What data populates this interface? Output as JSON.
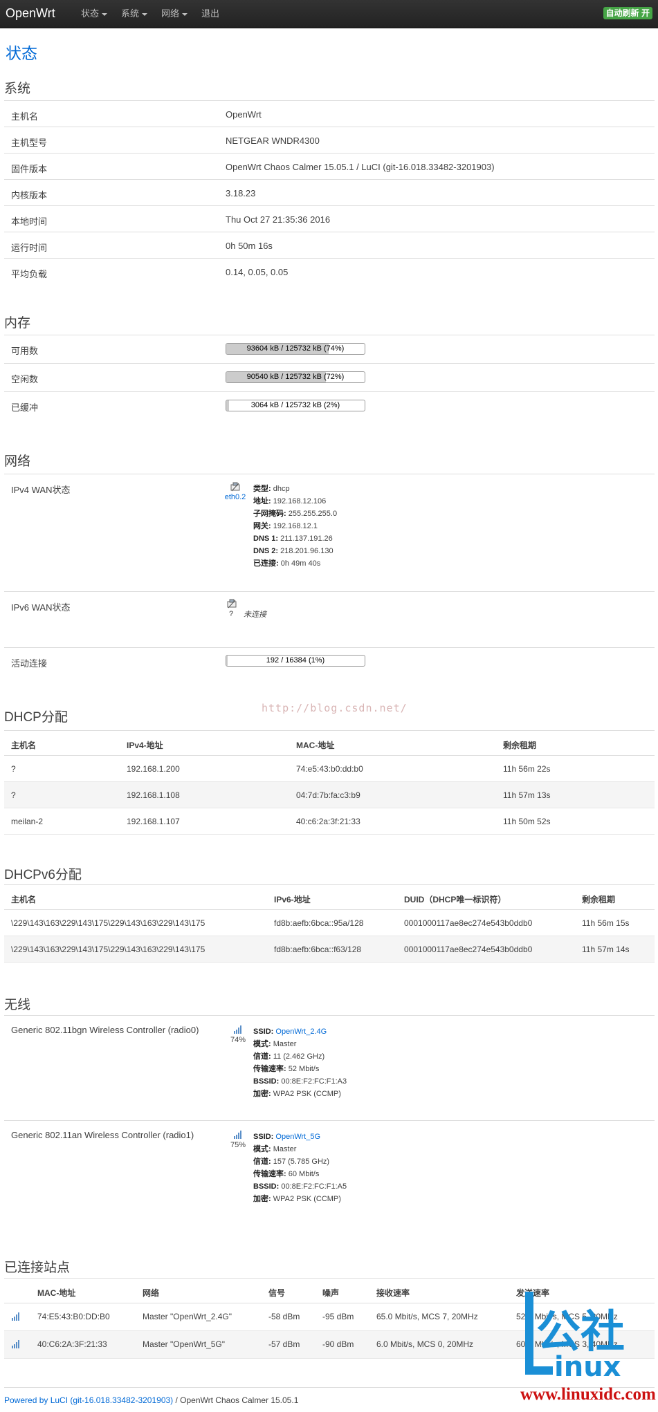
{
  "navbar": {
    "brand": "OpenWrt",
    "menu": [
      "状态",
      "系统",
      "网络",
      "退出"
    ],
    "auto_refresh": "自动刷新 开"
  },
  "page_title": "状态",
  "system": {
    "title": "系统",
    "rows": [
      {
        "label": "主机名",
        "value": "OpenWrt"
      },
      {
        "label": "主机型号",
        "value": "NETGEAR WNDR4300"
      },
      {
        "label": "固件版本",
        "value": "OpenWrt Chaos Calmer 15.05.1 / LuCI (git-16.018.33482-3201903)"
      },
      {
        "label": "内核版本",
        "value": "3.18.23"
      },
      {
        "label": "本地时间",
        "value": "Thu Oct 27 21:35:36 2016"
      },
      {
        "label": "运行时间",
        "value": "0h 50m 16s"
      },
      {
        "label": "平均负载",
        "value": "0.14, 0.05, 0.05"
      }
    ]
  },
  "memory": {
    "title": "内存",
    "rows": [
      {
        "label": "可用数",
        "text": "93604 kB / 125732 kB (74%)",
        "percent": 74
      },
      {
        "label": "空闲数",
        "text": "90540 kB / 125732 kB (72%)",
        "percent": 72
      },
      {
        "label": "已缓冲",
        "text": "3064 kB / 125732 kB (2%)",
        "percent": 2
      }
    ]
  },
  "network": {
    "title": "网络",
    "ipv4_label": "IPv4 WAN状态",
    "ipv4_iface": "eth0.2",
    "ipv4_lines": [
      {
        "k": "类型:",
        "v": "dhcp"
      },
      {
        "k": "地址:",
        "v": "192.168.12.106"
      },
      {
        "k": "子网掩码:",
        "v": "255.255.255.0"
      },
      {
        "k": "网关:",
        "v": "192.168.12.1"
      },
      {
        "k": "DNS 1:",
        "v": "211.137.191.26"
      },
      {
        "k": "DNS 2:",
        "v": "218.201.96.130"
      },
      {
        "k": "已连接:",
        "v": "0h 49m 40s"
      }
    ],
    "ipv6_label": "IPv6 WAN状态",
    "ipv6_iface": "?",
    "ipv6_status": "未连接",
    "conn_label": "活动连接",
    "conn_text": "192 / 16384 (1%)",
    "conn_percent": 1
  },
  "watermark": "http://blog.csdn.net/",
  "dhcp": {
    "title": "DHCP分配",
    "headers": [
      "主机名",
      "IPv4-地址",
      "MAC-地址",
      "剩余租期"
    ],
    "rows": [
      [
        "?",
        "192.168.1.200",
        "74:e5:43:b0:dd:b0",
        "11h 56m 22s"
      ],
      [
        "?",
        "192.168.1.108",
        "04:7d:7b:fa:c3:b9",
        "11h 57m 13s"
      ],
      [
        "meilan-2",
        "192.168.1.107",
        "40:c6:2a:3f:21:33",
        "11h 50m 52s"
      ]
    ]
  },
  "dhcpv6": {
    "title": "DHCPv6分配",
    "headers": [
      "主机名",
      "IPv6-地址",
      "DUID（DHCP唯一标识符）",
      "剩余租期"
    ],
    "rows": [
      [
        "\\229\\143\\163\\229\\143\\175\\229\\143\\163\\229\\143\\175",
        "fd8b:aefb:6bca::95a/128",
        "0001000117ae8ec274e543b0ddb0",
        "11h 56m 15s"
      ],
      [
        "\\229\\143\\163\\229\\143\\175\\229\\143\\163\\229\\143\\175",
        "fd8b:aefb:6bca::f63/128",
        "0001000117ae8ec274e543b0ddb0",
        "11h 57m 14s"
      ]
    ]
  },
  "wireless": {
    "title": "无线",
    "radios": [
      {
        "label": "Generic 802.11bgn Wireless Controller (radio0)",
        "signal": "74%",
        "ssid_k": "SSID:",
        "ssid": "OpenWrt_2.4G",
        "lines": [
          {
            "k": "模式:",
            "v": "Master"
          },
          {
            "k": "信道:",
            "v": "11 (2.462 GHz)"
          },
          {
            "k": "传输速率:",
            "v": "52 Mbit/s"
          },
          {
            "k": "BSSID:",
            "v": "00:8E:F2:FC:F1:A3"
          },
          {
            "k": "加密:",
            "v": "WPA2 PSK (CCMP)"
          }
        ]
      },
      {
        "label": "Generic 802.11an Wireless Controller (radio1)",
        "signal": "75%",
        "ssid_k": "SSID:",
        "ssid": "OpenWrt_5G",
        "lines": [
          {
            "k": "模式:",
            "v": "Master"
          },
          {
            "k": "信道:",
            "v": "157 (5.785 GHz)"
          },
          {
            "k": "传输速率:",
            "v": "60 Mbit/s"
          },
          {
            "k": "BSSID:",
            "v": "00:8E:F2:FC:F1:A5"
          },
          {
            "k": "加密:",
            "v": "WPA2 PSK (CCMP)"
          }
        ]
      }
    ]
  },
  "stations": {
    "title": "已连接站点",
    "headers": [
      "MAC-地址",
      "网络",
      "信号",
      "噪声",
      "接收速率",
      "发送速率"
    ],
    "rows": [
      [
        "74:E5:43:B0:DD:B0",
        "Master \"OpenWrt_2.4G\"",
        "-58 dBm",
        "-95 dBm",
        "65.0 Mbit/s, MCS 7, 20MHz",
        "52.0 Mbit/s, MCS 5, 20MHz"
      ],
      [
        "40:C6:2A:3F:21:33",
        "Master \"OpenWrt_5G\"",
        "-57 dBm",
        "-90 dBm",
        "6.0 Mbit/s, MCS 0, 20MHz",
        "60.0 Mbit/s, MCS 3, 40MHz"
      ]
    ]
  },
  "footer": {
    "powered": "Powered by LuCI (git-16.018.33482-3201903)",
    "rest": " / OpenWrt Chaos Calmer 15.05.1"
  },
  "logo": {
    "text": "公社",
    "sub": "inux",
    "url": "www.linuxidc.com"
  },
  "colors": {
    "accent": "#0069d6",
    "badge": "#46a546",
    "logo_blue": "#1a8fd6",
    "logo_red": "#cc1111"
  }
}
